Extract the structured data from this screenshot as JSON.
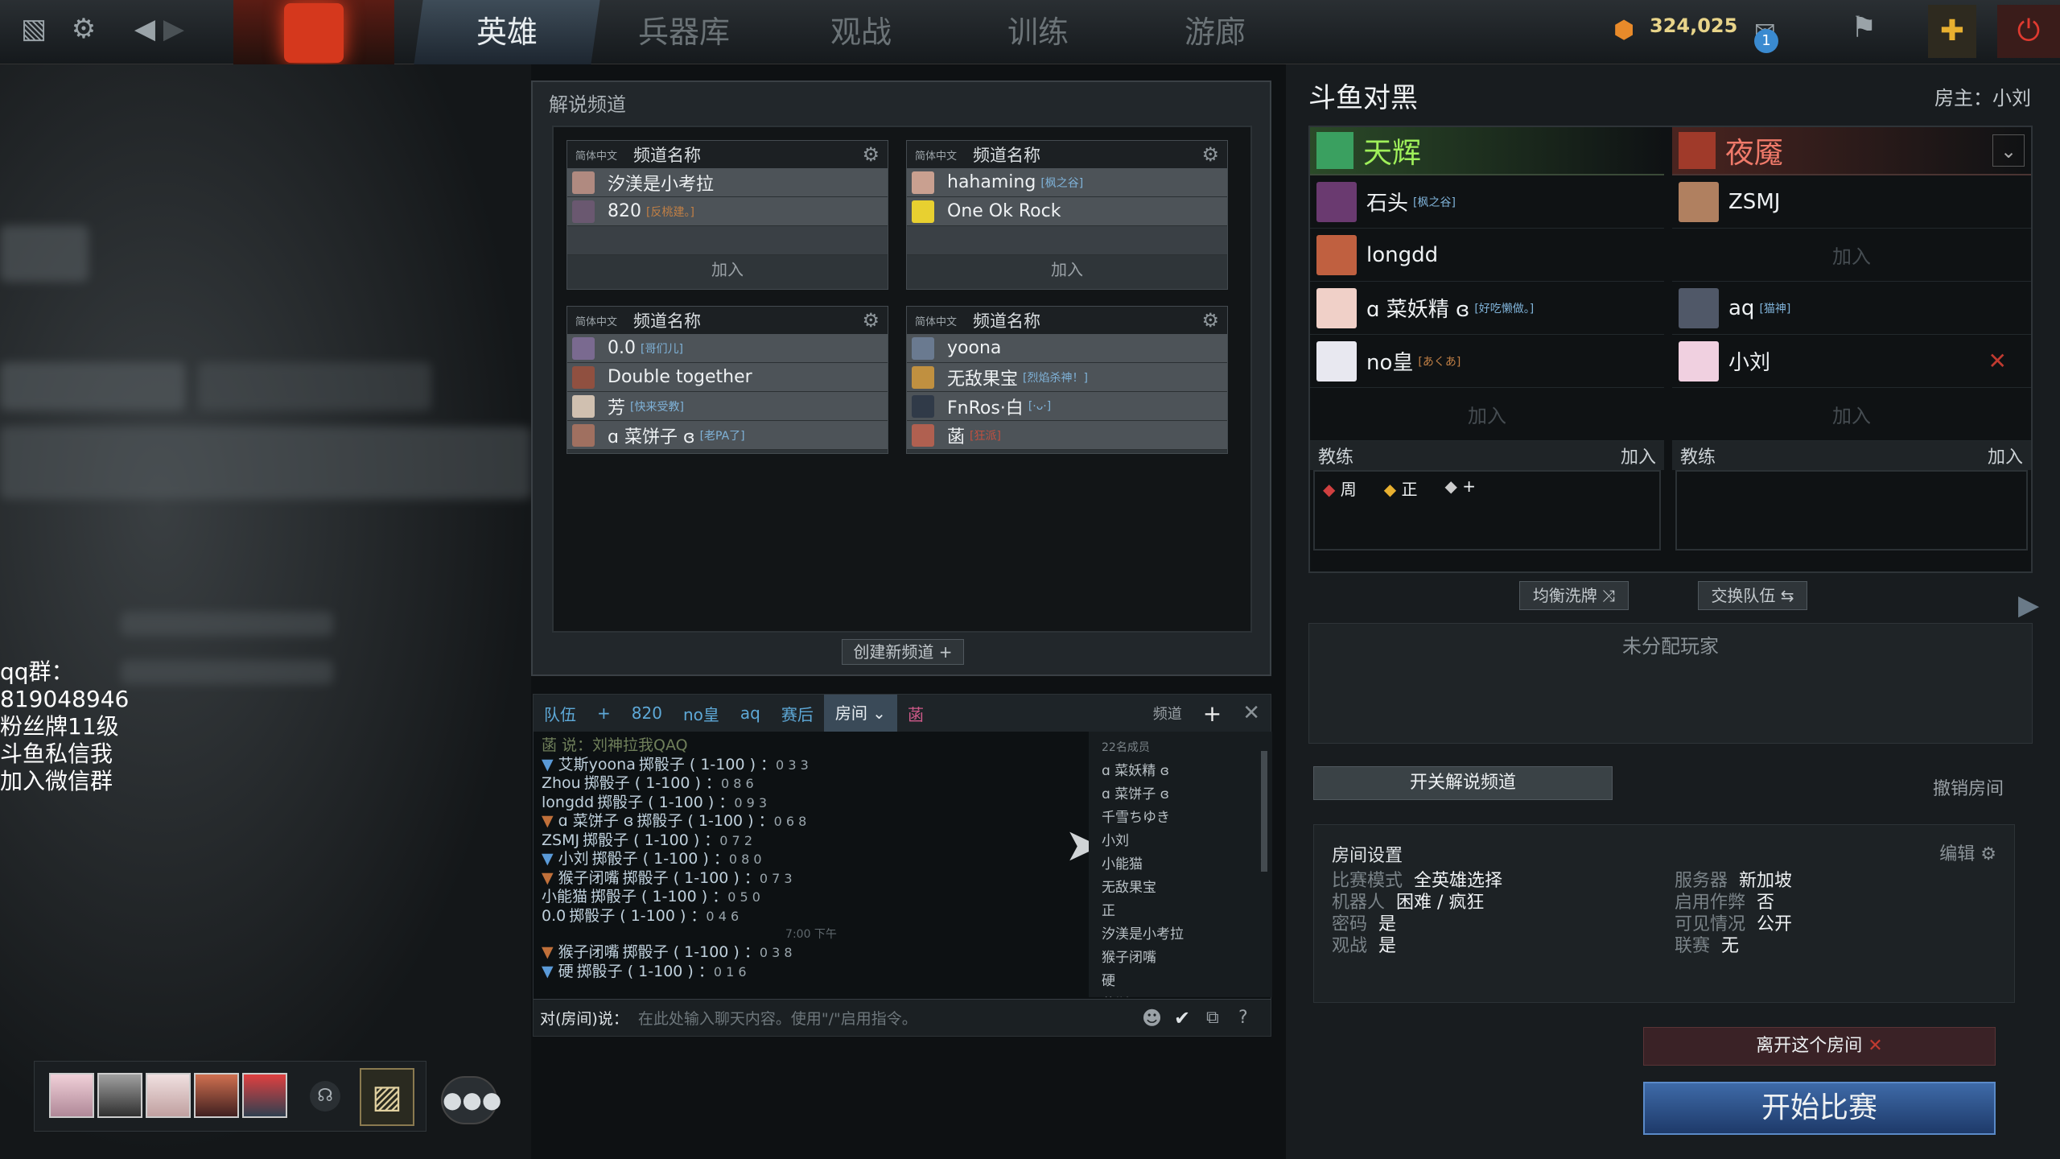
{
  "topnav": {
    "tabs": [
      {
        "label": "英雄",
        "active": true
      },
      {
        "label": "兵器库"
      },
      {
        "label": "观战"
      },
      {
        "label": "训练"
      },
      {
        "label": "游廊"
      }
    ],
    "currency": "324,025",
    "notification_count": "1"
  },
  "left_overlay": {
    "lines": [
      "qq群：",
      "819048946",
      "粉丝牌11级",
      "斗鱼私信我",
      "加入微信群"
    ]
  },
  "channels_panel": {
    "title": "解说频道",
    "channels": [
      {
        "lang": "简体中文",
        "name": "频道名称",
        "members": [
          {
            "name": "汐渼是小考拉",
            "tag": ""
          },
          {
            "name": "820",
            "tag": "[反桃建。]"
          }
        ],
        "join": "加入"
      },
      {
        "lang": "简体中文",
        "name": "频道名称",
        "members": [
          {
            "name": "hahaming",
            "tag": "[枫之谷]"
          },
          {
            "name": "One Ok Rock",
            "tag": ""
          }
        ],
        "join": "加入"
      },
      {
        "lang": "简体中文",
        "name": "频道名称",
        "members": [
          {
            "name": "0.0",
            "tag": "[哥们儿]"
          },
          {
            "name": "Double together",
            "tag": ""
          },
          {
            "name": "芳",
            "tag": "[快来受教]"
          },
          {
            "name": "ɑ 菜饼子 ɞ",
            "tag": "[老PA了]"
          }
        ]
      },
      {
        "lang": "简体中文",
        "name": "频道名称",
        "members": [
          {
            "name": "yoona",
            "tag": ""
          },
          {
            "name": "无敌果宝",
            "tag": "[烈焰杀神！]"
          },
          {
            "name": "FnRos·白",
            "tag": "[·ᴗ·]"
          },
          {
            "name": "菡",
            "tag": "[狂派]"
          }
        ]
      }
    ],
    "create_button": "创建新频道 +"
  },
  "chat": {
    "tabs": [
      "队伍",
      "+",
      "820",
      "no皇",
      "aq",
      "赛后",
      "房间",
      "菡"
    ],
    "active_tab": "房间",
    "channel_label": "频道",
    "first_line": "菡 说：刘神拉我QAQ",
    "messages": [
      {
        "name": "艾斯yoona",
        "text": "掷骰子 ( 1-100 ) ：",
        "val": "0 3 3",
        "icon": "blue"
      },
      {
        "name": "Zhou",
        "text": "掷骰子 ( 1-100 ) ：",
        "val": "0 8 6",
        "icon": ""
      },
      {
        "name": "longdd",
        "text": "掷骰子 ( 1-100 ) ：",
        "val": "0 9 3",
        "icon": ""
      },
      {
        "name": "ɑ 菜饼子 ɞ",
        "text": "掷骰子 ( 1-100 ) ：",
        "val": "0 6 8",
        "icon": "orange"
      },
      {
        "name": "ZSMJ",
        "text": "掷骰子 ( 1-100 ) ：",
        "val": "0 7 2",
        "icon": ""
      },
      {
        "name": "小刘",
        "text": "掷骰子 ( 1-100 ) ：",
        "val": "0 8 0",
        "icon": "blue"
      },
      {
        "name": "猴子闭嘴",
        "text": "掷骰子 ( 1-100 ) ：",
        "val": "0 7 3",
        "icon": "orange"
      },
      {
        "name": "小能猫",
        "text": "掷骰子 ( 1-100 ) ：",
        "val": "0 5 0",
        "icon": ""
      },
      {
        "name": "0.0",
        "text": "掷骰子 ( 1-100 ) ：",
        "val": "0 4 6",
        "icon": ""
      }
    ],
    "time_divider": "7:00 下午",
    "messages2": [
      {
        "name": "猴子闭嘴",
        "text": "掷骰子 ( 1-100 ) ：",
        "val": "0 3 8",
        "icon": "orange"
      },
      {
        "name": "硬",
        "text": "掷骰子 ( 1-100 ) ：",
        "val": "0 1 6",
        "icon": "blue"
      }
    ],
    "member_count": "22名成员",
    "members": [
      "ɑ 菜妖精 ɞ",
      "ɑ 菜饼子 ɞ",
      "千雪ちゆき",
      "小刘",
      "小能猫",
      "无敌果宝",
      "正",
      "汐渼是小考拉",
      "猴子闭嘴",
      "硬",
      "艾斯yoona"
    ],
    "input_label": "对(房间)说：",
    "input_placeholder": "在此处输入聊天内容。使用\"/\"启用指令。"
  },
  "lobby": {
    "title": "斗鱼对黑",
    "host": "房主：小刘",
    "radiant": {
      "label": "天辉",
      "players": [
        {
          "name": "石头",
          "tag": "[枫之谷]"
        },
        {
          "name": "longdd",
          "tag": ""
        },
        {
          "name": "ɑ 菜妖精 ɞ",
          "tag": "[好吃懒做。]"
        },
        {
          "name": "no皇",
          "tag": "[あくあ]"
        }
      ],
      "empty": "加入",
      "coach_label": "教练",
      "coach_join": "加入",
      "coaches": [
        "周",
        "正",
        "+"
      ]
    },
    "dire": {
      "label": "夜魇",
      "players": [
        {
          "name": "ZSMJ",
          "tag": ""
        },
        {
          "name": "",
          "tag": ""
        },
        {
          "name": "aq",
          "tag": "[猫神]"
        },
        {
          "name": "小刘",
          "tag": ""
        }
      ],
      "empty": "加入",
      "coach_label": "教练",
      "coach_join": "加入"
    },
    "balance_button": "均衡洗牌",
    "swap_button": "交换队伍",
    "unassigned": "未分配玩家",
    "caster_toggle": "开关解说频道",
    "cancel_room": "撤销房间",
    "settings": {
      "title": "房间设置",
      "edit": "编辑",
      "left": [
        {
          "k": "比赛模式",
          "v": "全英雄选择"
        },
        {
          "k": "机器人",
          "v": "困难 / 疯狂"
        },
        {
          "k": "密码",
          "v": "是"
        },
        {
          "k": "观战",
          "v": "是"
        }
      ],
      "right": [
        {
          "k": "服务器",
          "v": "新加坡"
        },
        {
          "k": "启用作弊",
          "v": "否"
        },
        {
          "k": "可见情况",
          "v": "公开"
        },
        {
          "k": "联赛",
          "v": "无"
        }
      ]
    },
    "leave_button": "离开这个房间",
    "start_button": "开始比赛"
  },
  "colors": {
    "radiant": "#8fe05a",
    "dire": "#e06a5a",
    "accent": "#3e6aa8"
  }
}
